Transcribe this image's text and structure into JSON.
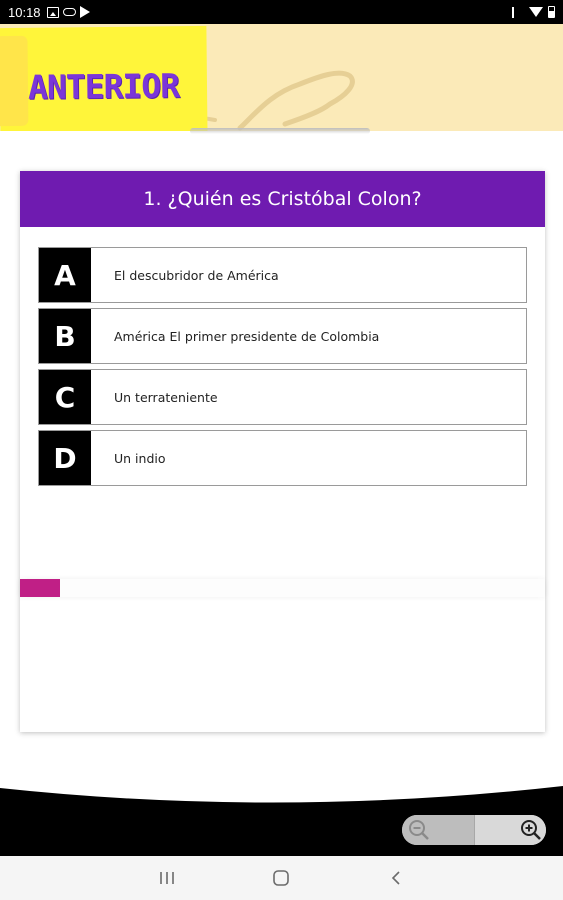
{
  "status_bar": {
    "time": "10:18",
    "left_icons": [
      "photo-icon",
      "cloud-icon",
      "play-store-icon"
    ],
    "right_icons": [
      "mute-icon",
      "wifi-icon",
      "battery-icon"
    ]
  },
  "header": {
    "prev_button_label": "ANTERIOR"
  },
  "quiz": {
    "question": "1. ¿Quién es Cristóbal Colon?",
    "options": [
      {
        "letter": "A",
        "text": "El descubridor de América"
      },
      {
        "letter": "B",
        "text": "América El primer presidente de Colombia"
      },
      {
        "letter": "C",
        "text": "Un terrateniente"
      },
      {
        "letter": "D",
        "text": "Un indio"
      }
    ],
    "progress_fraction": 0.077
  },
  "toolbar": {
    "zoom_out_icon": "zoom-out-icon",
    "zoom_in_icon": "zoom-in-icon"
  },
  "nav_bar": {
    "icons": [
      "recents-icon",
      "home-icon",
      "back-icon"
    ]
  },
  "colors": {
    "header_banner": "#fbeab8",
    "prev_button_bg": "#fff53a",
    "prev_button_text": "#7b36d8",
    "question_header": "#6f1bb0",
    "progress_fill": "#c01f86"
  }
}
